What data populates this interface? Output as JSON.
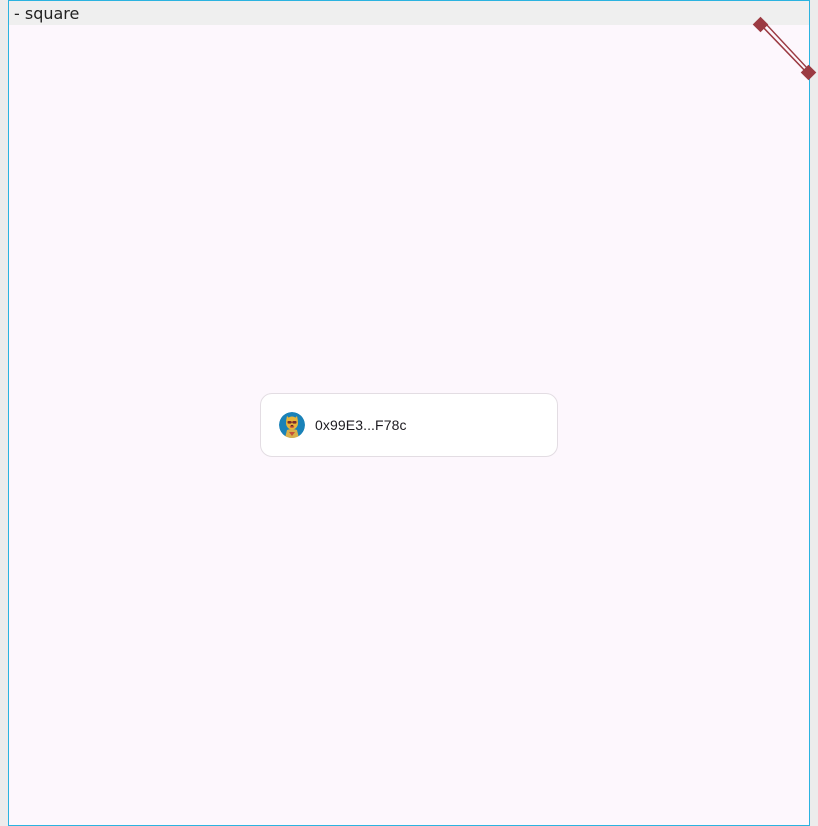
{
  "window": {
    "title": "- square",
    "border_color": "#2bb3e0",
    "background_color": "#fdf7fd",
    "title_bar_color": "#efefef"
  },
  "resize_handle": {
    "icon": "diagonal-resize-handle-icon",
    "color": "#9b3a42"
  },
  "account": {
    "address": "0x99E3...F78c",
    "avatar_icon": "nft-avatar-icon",
    "avatar_colors": [
      "#1a82b8",
      "#e8b53a",
      "#c4513a"
    ]
  }
}
